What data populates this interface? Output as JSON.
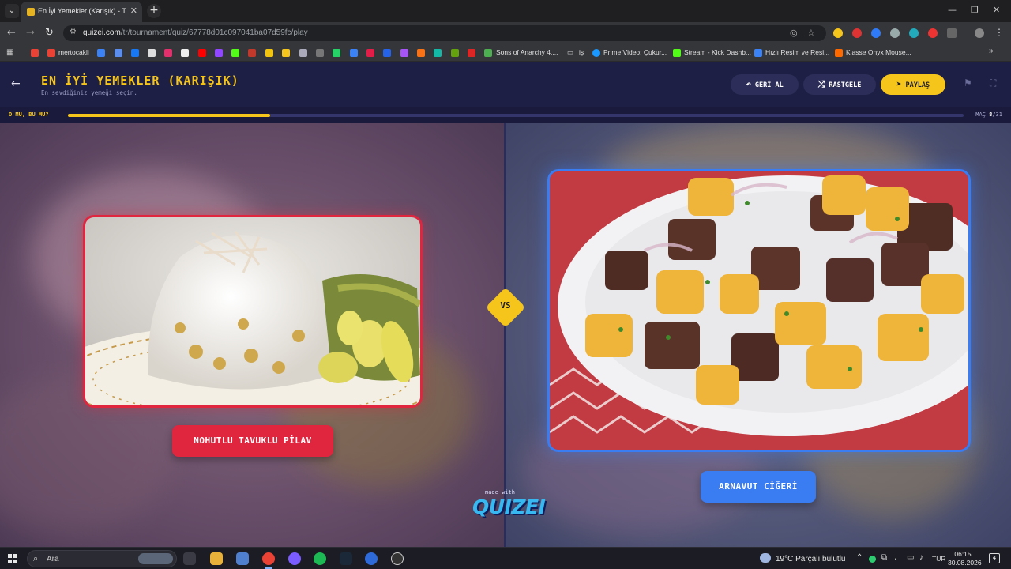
{
  "browser": {
    "tab_title": "En İyi Yemekler (Karışık) - Tier Li",
    "url_host": "quizei.com",
    "url_path": "/tr/tournament/quiz/67778d01c097041ba07d59fc/play",
    "bookmarks": [
      {
        "label": "mertocakli",
        "color": "#ea4335"
      },
      {
        "label": "Sons of Anarchy 4....",
        "color": "#4caf50"
      },
      {
        "label": "iş",
        "color": "#cccccc"
      },
      {
        "label": "Prime Video: Çukur...",
        "color": "#1a98ff"
      },
      {
        "label": "Stream - Kick Dashb...",
        "color": "#53fc18"
      },
      {
        "label": "Hızlı Resim ve Resi...",
        "color": "#3b82f6"
      },
      {
        "label": "Klasse Onyx Mouse...",
        "color": "#ff6a00"
      }
    ]
  },
  "header": {
    "title": "EN İYİ YEMEKLER (KARIŞIK)",
    "subtitle": "En sevdiğiniz yemeği seçin.",
    "undo_label": "GERİ AL",
    "random_label": "RASTGELE",
    "share_label": "PAYLAŞ"
  },
  "progress": {
    "label": "O MU, BU MU?",
    "match_prefix": "MAÇ",
    "current": "8",
    "total": "/31",
    "fill_fraction": 0.226
  },
  "match": {
    "vs": "VS",
    "left_option": "NOHUTLU TAVUKLU PİLAV",
    "right_option": "ARNAVUT CİĞERİ"
  },
  "branding": {
    "made_with": "made with",
    "name": "QUIZEI"
  },
  "taskbar": {
    "search_placeholder": "Ara",
    "weather": "19°C  Parçalı bulutlu",
    "lang": "TUR",
    "time": "06:15",
    "date": "30.08.2026"
  }
}
